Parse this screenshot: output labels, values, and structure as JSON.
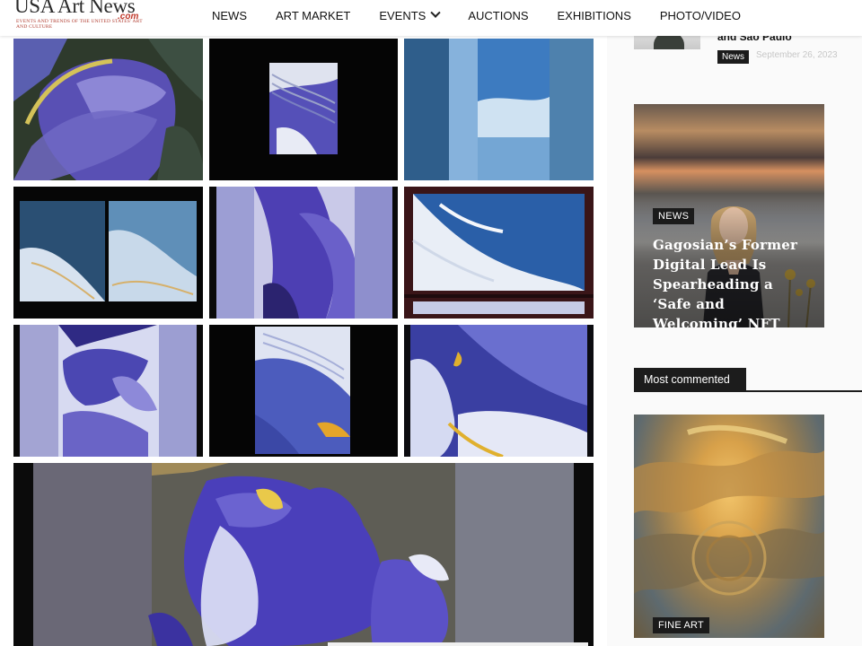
{
  "site": {
    "logo_text": "USA Art News",
    "logo_suffix": ".com",
    "logo_tagline": "Events and trends of the United States' Art and Culture"
  },
  "nav": {
    "items": [
      "NEWS",
      "ART MARKET",
      "EVENTS",
      "AUCTIONS",
      "EXHIBITIONS",
      "PHOTO/VIDEO"
    ]
  },
  "sidebar": {
    "top_article": {
      "title_fragment": "and São Paulo",
      "category": "News",
      "date": "September 26, 2023"
    },
    "feature_article": {
      "category": "NEWS",
      "title": "Gagosian’s Former Digital Lead Is Spearheading a ‘Safe and Welcoming’ NFT"
    },
    "most_commented_label": "Most commented",
    "fine_art_article": {
      "category": "FINE ART"
    }
  },
  "colors": {
    "accent_dark": "#1b1b1b",
    "logo_red": "#c0392b",
    "iris_purple": "#5a4fc4"
  }
}
